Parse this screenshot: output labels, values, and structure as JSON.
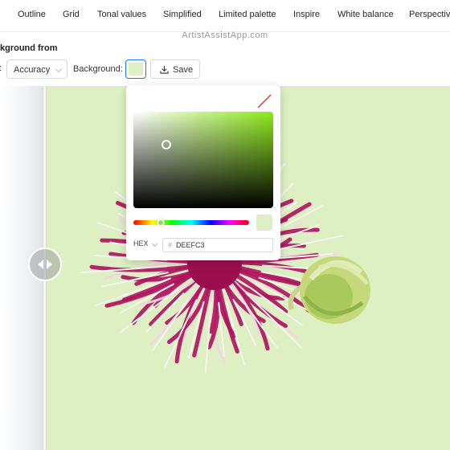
{
  "nav": {
    "items": [
      "Outline",
      "Grid",
      "Tonal values",
      "Simplified",
      "Limited palette",
      "Inspire",
      "White balance",
      "Perspective"
    ]
  },
  "watermark": "ArtistAssistApp.com",
  "toolbar": {
    "subtitle": "kground from",
    "colon_fragment": ":",
    "mode_value": "Accuracy",
    "background_label": "Background:",
    "background_color": "#DEEFC3",
    "save_label": "Save"
  },
  "picker": {
    "format": "HEX",
    "hex_value": "DEEFC3",
    "hue_color": "#8ee81a",
    "preview_color": "#DEEFC3"
  },
  "colors": {
    "accent": "#1677ff",
    "image_background": "#DEEFC3",
    "flower_magenta": "#b0155f",
    "flower_light": "#f2d6e2",
    "bud_green": "#b8d36a"
  }
}
